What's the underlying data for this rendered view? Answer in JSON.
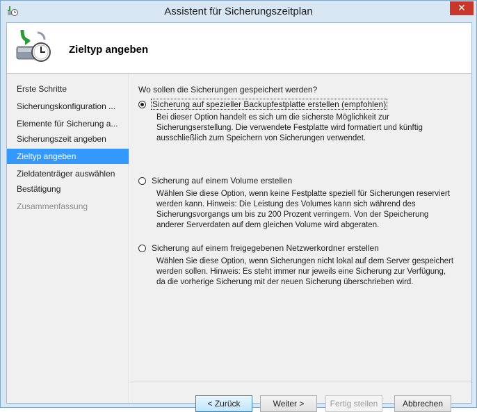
{
  "window": {
    "title": "Assistent für Sicherungszeitplan",
    "close_symbol": "✕",
    "icon": "backup-schedule-icon"
  },
  "header": {
    "title": "Zieltyp angeben",
    "icon": "backup-disk-clock-icon"
  },
  "nav": {
    "items": [
      {
        "label": "Erste Schritte",
        "state": "normal"
      },
      {
        "label": "Sicherungskonfiguration ...",
        "state": "normal"
      },
      {
        "label": "Elemente für Sicherung a...",
        "state": "normal"
      },
      {
        "label": "Sicherungszeit angeben",
        "state": "normal"
      },
      {
        "label": "Zieltyp angeben",
        "state": "active"
      },
      {
        "label": "Zieldatenträger auswählen",
        "state": "normal"
      },
      {
        "label": "Bestätigung",
        "state": "normal"
      },
      {
        "label": "Zusammenfassung",
        "state": "disabled"
      }
    ]
  },
  "content": {
    "question": "Wo sollen die Sicherungen gespeichert werden?",
    "options": [
      {
        "label": "Sicherung auf spezieller Backupfestplatte erstellen (empfohlen)",
        "checked": true,
        "description": [
          "Bei dieser Option handelt es sich um die sicherste Möglichkeit zur",
          "Sicherungserstellung. Die verwendete Festplatte wird formatiert und künftig",
          "ausschließlich zum Speichern von Sicherungen verwendet."
        ]
      },
      {
        "label": "Sicherung auf einem Volume erstellen",
        "checked": false,
        "description": [
          "Wählen Sie diese Option, wenn keine Festplatte speziell für Sicherungen reserviert",
          "werden kann. Hinweis: Die Leistung des Volumes kann sich während des",
          "Sicherungsvorgangs um bis zu 200 Prozent verringern. Von der Speicherung",
          "anderer Serverdaten auf dem gleichen Volume wird abgeraten."
        ]
      },
      {
        "label": "Sicherung auf einem freigegebenen Netzwerkordner erstellen",
        "checked": false,
        "description": [
          "Wählen Sie diese Option, wenn Sicherungen nicht lokal auf dem Server gespeichert",
          "werden sollen. Hinweis: Es steht immer nur jeweils eine Sicherung zur Verfügung,",
          "da die vorherige Sicherung mit der neuen Sicherung überschrieben wird."
        ]
      }
    ]
  },
  "buttons": {
    "back": "< Zurück",
    "next": "Weiter >",
    "finish": "Fertig stellen",
    "cancel": "Abbrechen"
  },
  "colors": {
    "selection": "#3399ff",
    "titlebar": "#d9e7f4",
    "close": "#c7372b"
  }
}
